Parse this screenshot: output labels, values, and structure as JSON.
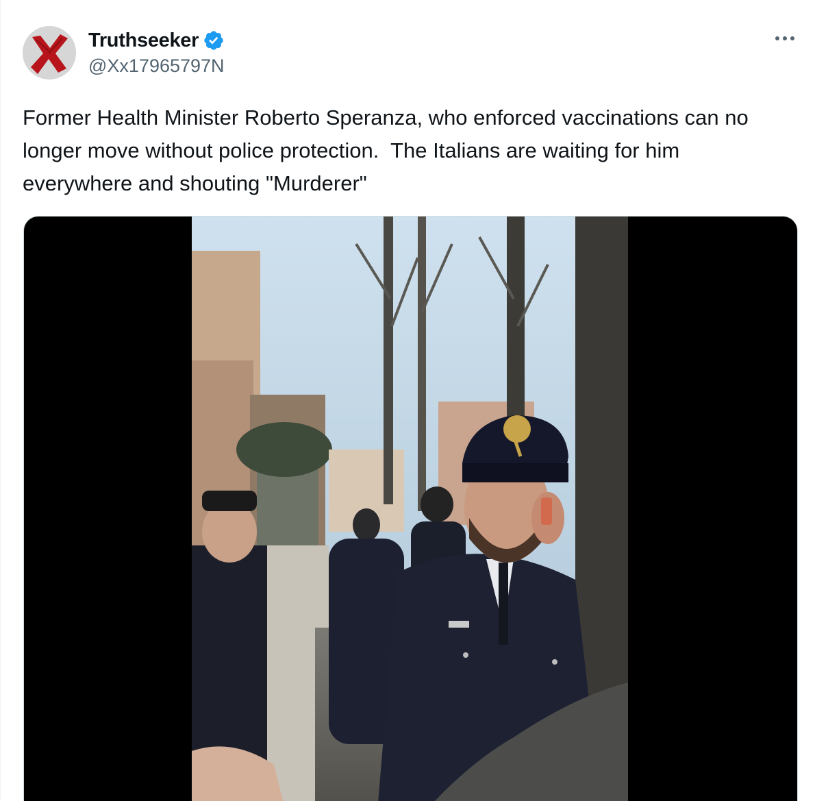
{
  "author": {
    "display_name": "Truthseeker",
    "handle": "@Xx17965797N",
    "verified": true
  },
  "icons": {
    "avatar": "red-x-avatar",
    "verified": "verified-badge-icon",
    "more": "more-options-icon"
  },
  "tweet": {
    "text": "Former Health Minister Roberto Speranza, who enforced vaccinations can no longer move without police protection.  The Italians are waiting for him everywhere and shouting \"Murderer\""
  },
  "media": {
    "type": "video",
    "scene": "carabinieri officer in uniform cap holding phone on a city street"
  },
  "colors": {
    "text_primary": "#0f1419",
    "text_secondary": "#536471",
    "verified_blue": "#1d9bf0",
    "media_background": "#000000"
  }
}
